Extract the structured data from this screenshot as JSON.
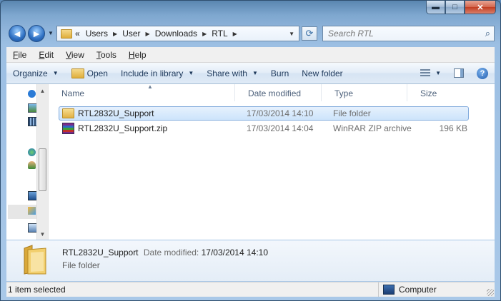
{
  "window": {
    "minimize_glyph": "▬",
    "maximize_glyph": "□",
    "close_glyph": "✕"
  },
  "nav": {
    "back_glyph": "◄",
    "forward_glyph": "►",
    "breadcrumbs": [
      "«",
      "Users",
      "User",
      "Downloads",
      "RTL"
    ],
    "search_placeholder": "Search RTL"
  },
  "menu": {
    "file": "ile",
    "file_key": "F",
    "edit": "dit",
    "edit_key": "E",
    "view": "iew",
    "view_key": "V",
    "tools": "ools",
    "tools_key": "T",
    "help": "elp",
    "help_key": "H"
  },
  "commands": {
    "organize": "Organize",
    "open": "Open",
    "include_in_library": "Include in library",
    "share_with": "Share with",
    "burn": "Burn",
    "new_folder": "New folder"
  },
  "columns": {
    "name": "Name",
    "date_modified": "Date modified",
    "type": "Type",
    "size": "Size"
  },
  "files": [
    {
      "name": "RTL2832U_Support",
      "date": "17/03/2014 14:10",
      "type": "File folder",
      "size": "",
      "icon": "folder-icon",
      "selected": true
    },
    {
      "name": "RTL2832U_Support.zip",
      "date": "17/03/2014 14:04",
      "type": "WinRAR ZIP archive",
      "size": "196 KB",
      "icon": "winrar-zip-icon",
      "selected": false
    }
  ],
  "details": {
    "name": "RTL2832U_Support",
    "date_label": "Date modified:",
    "date_value": "17/03/2014 14:10",
    "type": "File folder"
  },
  "status": {
    "selection": "1 item selected",
    "location": "Computer"
  }
}
